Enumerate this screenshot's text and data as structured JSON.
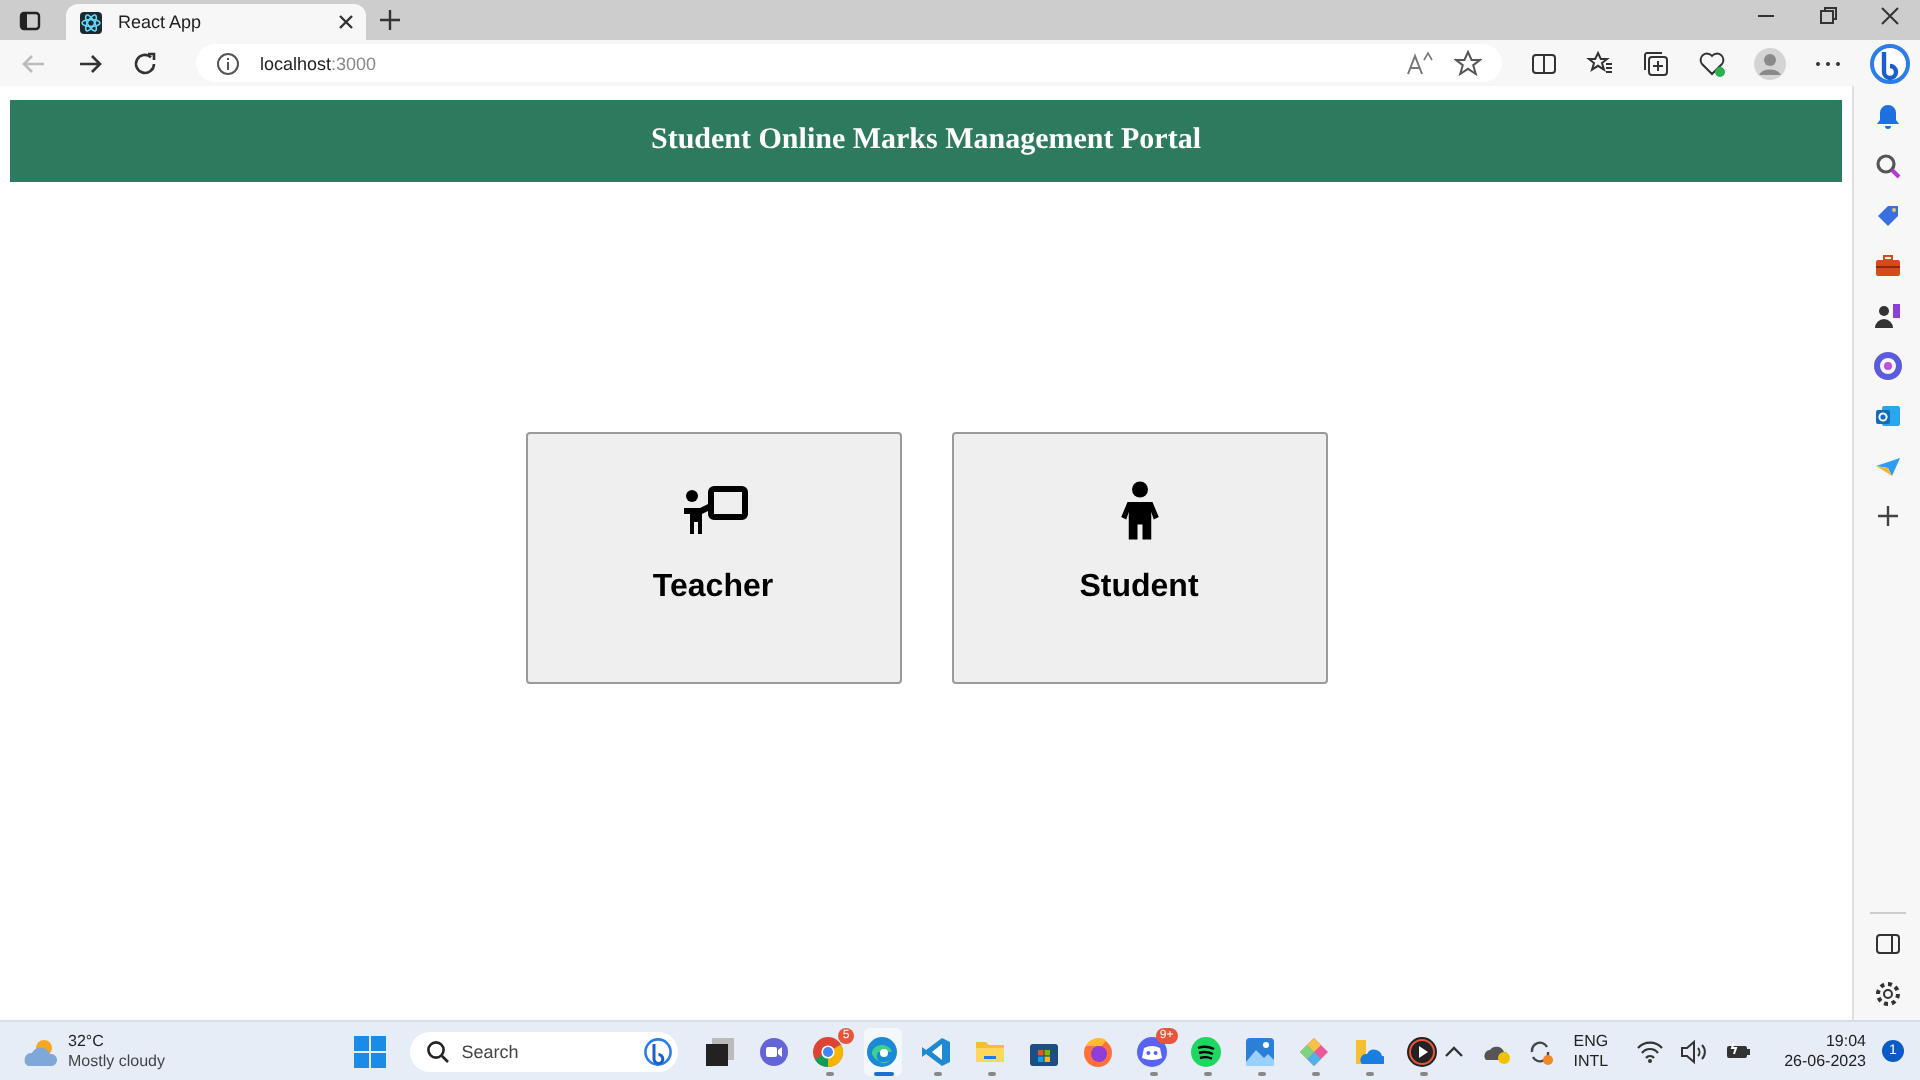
{
  "browser": {
    "tabs": [
      {
        "title": "React App",
        "selected": true
      }
    ],
    "url_host": "localhost",
    "url_port": ":3000"
  },
  "page": {
    "header_title": "Student Online Marks Management Portal",
    "cards": [
      {
        "kind": "teacher",
        "label": "Teacher"
      },
      {
        "kind": "student",
        "label": "Student"
      }
    ]
  },
  "taskbar": {
    "weather": {
      "temperature": "32°C",
      "condition": "Mostly cloudy"
    },
    "search_placeholder": "Search",
    "apps": [
      {
        "kind": "taskview",
        "running": false,
        "selected": false
      },
      {
        "kind": "chat",
        "running": false,
        "selected": false
      },
      {
        "kind": "chrome",
        "running": true,
        "selected": false,
        "badge": "5"
      },
      {
        "kind": "edge",
        "running": true,
        "selected": true
      },
      {
        "kind": "vscode",
        "running": true,
        "selected": false
      },
      {
        "kind": "folder",
        "running": true,
        "selected": false
      },
      {
        "kind": "store",
        "running": false,
        "selected": false
      },
      {
        "kind": "firefox",
        "running": false,
        "selected": false
      },
      {
        "kind": "discord",
        "running": true,
        "selected": false,
        "badge": "9+"
      },
      {
        "kind": "spotify",
        "running": true,
        "selected": false
      },
      {
        "kind": "photos",
        "running": true,
        "selected": false
      },
      {
        "kind": "diamond",
        "running": true,
        "selected": false
      },
      {
        "kind": "cloudfolder",
        "running": true,
        "selected": false
      },
      {
        "kind": "player",
        "running": true,
        "selected": false
      }
    ],
    "language": "ENG",
    "layout": "INTL",
    "time": "19:04",
    "date": "26-06-2023",
    "notifications": "1"
  }
}
